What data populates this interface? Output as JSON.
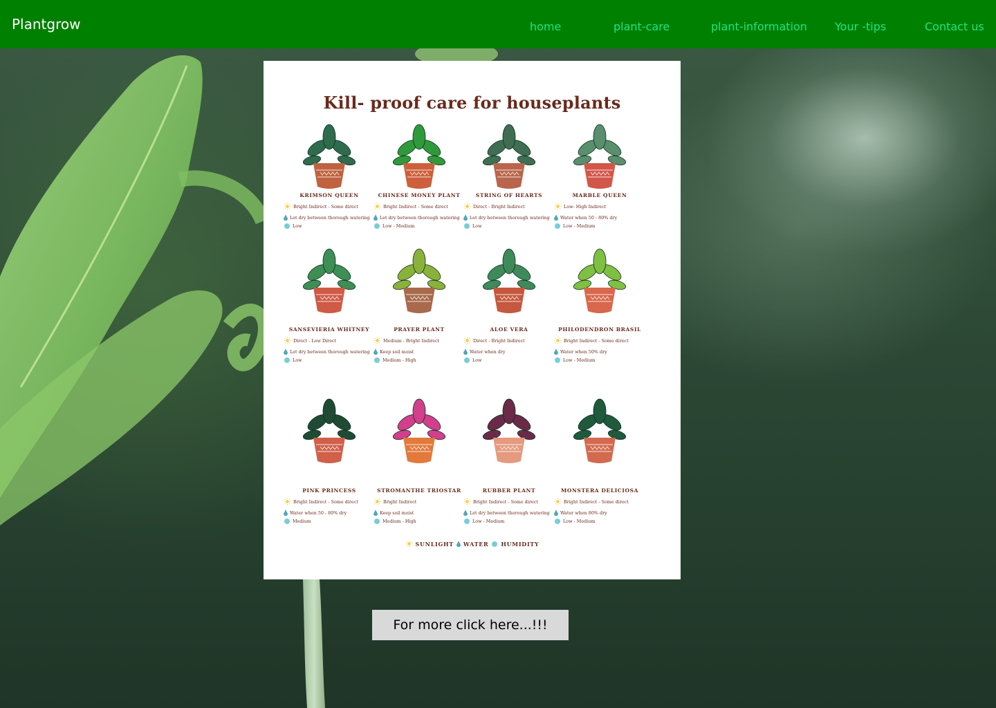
{
  "header": {
    "brand": "Plantgrow",
    "nav": [
      "home",
      "plant-care",
      "plant-information",
      "Your -tips",
      "Contact us"
    ]
  },
  "poster": {
    "title": "Kill- proof care for houseplants",
    "plants": [
      {
        "name": "Krimson Queen",
        "light": "Bright Indirect - Some direct",
        "water": "Let dry between thorough watering",
        "humidity": "Low"
      },
      {
        "name": "Chinese Money Plant",
        "light": "Bright Indirect - Some direct",
        "water": "Let dry between thorough watering",
        "humidity": "Low - Medium"
      },
      {
        "name": "String of Hearts",
        "light": "Direct - Bright Indirect",
        "water": "Let dry between thorough watering",
        "humidity": "Low"
      },
      {
        "name": "Marble Queen",
        "light": "Low- High Indirect",
        "water": "Water when 50 - 80% dry",
        "humidity": "Low - Medium"
      },
      {
        "name": "Sansevieria Whitney",
        "light": "Direct - Low Direct",
        "water": "Let dry between thorough watering",
        "humidity": "Low"
      },
      {
        "name": "Prayer Plant",
        "light": "Medium - Bright Indirect",
        "water": "Keep soil moist",
        "humidity": "Medium - High"
      },
      {
        "name": "Aloe Vera",
        "light": "Direct - Bright Indirect",
        "water": "Water when dry",
        "humidity": "Low"
      },
      {
        "name": "Philodendron Brasil",
        "light": "Bright Indirect - Some direct",
        "water": "Water when 50% dry",
        "humidity": "Low - Medium"
      },
      {
        "name": "Pink Princess",
        "light": "Bright Indirect - Some direct",
        "water": "Water when 50 - 80% dry",
        "humidity": "Medium"
      },
      {
        "name": "Stromanthe Triostar",
        "light": "Bright Indirect",
        "water": "Keep soil moist",
        "humidity": "Medium - High"
      },
      {
        "name": "Rubber Plant",
        "light": "Bright Indirect - Some direct",
        "water": "Let dry between thorough watering",
        "humidity": "Low - Medium"
      },
      {
        "name": "Monstera Deliciosa",
        "light": "Bright Indirect - Some direct",
        "water": "Water when 80% dry",
        "humidity": "Low - Medium"
      }
    ],
    "legend": {
      "sunlight": "Sunlight",
      "water": "Water",
      "humidity": "Humidity"
    }
  },
  "button": {
    "label": "For more click here...!!!"
  },
  "colors": {
    "header": "#008000",
    "nav_link": "#1ee28a",
    "poster_text": "#6a2a1c",
    "button_bg": "#d9d9d9"
  }
}
